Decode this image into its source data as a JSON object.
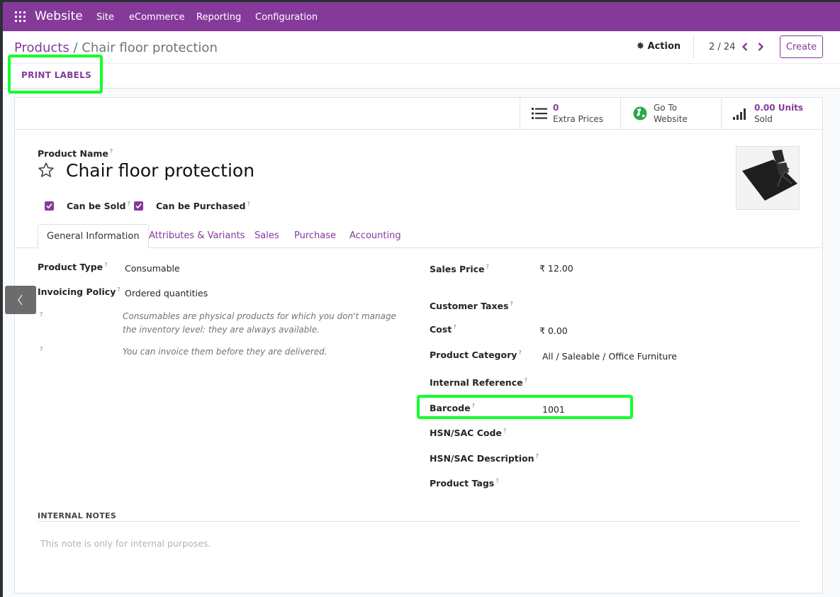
{
  "navbar": {
    "brand": "Website",
    "menus": [
      "Site",
      "eCommerce",
      "Reporting",
      "Configuration"
    ]
  },
  "breadcrumb": {
    "parent": "Products",
    "separator": "/",
    "current": "Chair floor protection"
  },
  "toolbar": {
    "action_label": "Action",
    "pager": "2 / 24",
    "create_label": "Create",
    "print_labels": "PRINT LABELS"
  },
  "smart_buttons": [
    {
      "value": "0",
      "label": "Extra Prices",
      "icon": "list-icon"
    },
    {
      "value": "Go To",
      "label": "Website",
      "icon": "globe-icon"
    },
    {
      "value": "0.00 Units",
      "label": "Sold",
      "icon": "bar-signal-icon"
    }
  ],
  "product": {
    "name_label": "Product Name",
    "name": "Chair floor protection",
    "can_be_sold_label": "Can be Sold",
    "can_be_purchased_label": "Can be Purchased",
    "can_be_sold": true,
    "can_be_purchased": true
  },
  "tabs": [
    "General Information",
    "Attributes & Variants",
    "Sales",
    "Purchase",
    "Accounting"
  ],
  "left_fields": {
    "product_type_label": "Product Type",
    "product_type": "Consumable",
    "invoicing_policy_label": "Invoicing Policy",
    "invoicing_policy": "Ordered quantities",
    "help_consumable": "Consumables are physical products for which you don't manage the inventory level: they are always available.",
    "help_invoice": "You can invoice them before they are delivered."
  },
  "right_fields": {
    "sales_price_label": "Sales Price",
    "sales_price": "₹ 12.00",
    "customer_taxes_label": "Customer Taxes",
    "cost_label": "Cost",
    "cost": "₹ 0.00",
    "category_label": "Product Category",
    "category": "All / Saleable / Office Furniture",
    "internal_ref_label": "Internal Reference",
    "barcode_label": "Barcode",
    "barcode": "1001",
    "hsn_code_label": "HSN/SAC Code",
    "hsn_desc_label": "HSN/SAC Description",
    "tags_label": "Product Tags"
  },
  "notes": {
    "title": "INTERNAL NOTES",
    "placeholder": "This note is only for internal purposes."
  },
  "help_mark": "?",
  "colors": {
    "brand": "#853a9a",
    "highlight": "#12ff2a"
  }
}
